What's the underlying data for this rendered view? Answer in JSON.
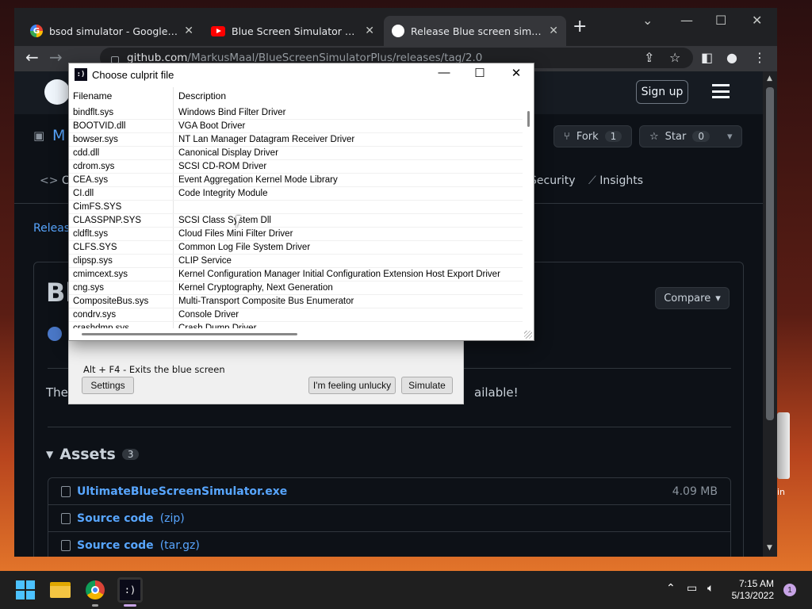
{
  "browser": {
    "tabs": [
      {
        "title": "bsod simulator - Google Search",
        "icon": "google-icon"
      },
      {
        "title": "Blue Screen Simulator Plus - Yo",
        "icon": "youtube-icon"
      },
      {
        "title": "Release Blue screen simulator",
        "icon": "github-icon"
      }
    ],
    "new_tab": "+",
    "url_host": "github.com",
    "url_path": "/MarkusMaal/BlueScreenSimulatorPlus/releases/tag/2.0"
  },
  "github": {
    "signup": "Sign up",
    "repo_initial": "M",
    "fork_label": "Fork",
    "fork_count": "1",
    "star_label": "Star",
    "star_count": "0",
    "tab_code": "C",
    "tab_security": "Security",
    "tab_insights": "Insights",
    "releases_link": "Release",
    "release_title": "Bl",
    "compare": "Compare",
    "desc_left": "The",
    "desc_right": "ailable!",
    "assets_label": "Assets",
    "assets_count": "3",
    "assets": [
      {
        "name": "UltimateBlueScreenSimulator.exe",
        "type": "",
        "size": "4.09 MB"
      },
      {
        "name": "Source code",
        "type": "(zip)",
        "size": ""
      },
      {
        "name": "Source code",
        "type": "(tar.gz)",
        "size": ""
      }
    ]
  },
  "simulator": {
    "hint": "Alt + F4 - Exits the blue screen",
    "settings": "Settings",
    "unlucky": "I'm feeling unlucky",
    "simulate": "Simulate"
  },
  "dialog": {
    "title": "Choose culprit file",
    "app_icon_text": ":)",
    "col_filename": "Filename",
    "col_description": "Description",
    "rows": [
      {
        "file": "bindflt.sys",
        "desc": "Windows Bind Filter Driver"
      },
      {
        "file": "BOOTVID.dll",
        "desc": "VGA Boot Driver"
      },
      {
        "file": "bowser.sys",
        "desc": "NT Lan Manager Datagram Receiver Driver"
      },
      {
        "file": "cdd.dll",
        "desc": "Canonical Display Driver"
      },
      {
        "file": "cdrom.sys",
        "desc": "SCSI CD-ROM Driver"
      },
      {
        "file": "CEA.sys",
        "desc": "Event Aggregation Kernel Mode Library"
      },
      {
        "file": "CI.dll",
        "desc": "Code Integrity Module"
      },
      {
        "file": "CimFS.SYS",
        "desc": ""
      },
      {
        "file": "CLASSPNP.SYS",
        "desc": "SCSI Class System Dll"
      },
      {
        "file": "cldflt.sys",
        "desc": "Cloud Files Mini Filter Driver"
      },
      {
        "file": "CLFS.SYS",
        "desc": "Common Log File System Driver"
      },
      {
        "file": "clipsp.sys",
        "desc": "CLIP Service"
      },
      {
        "file": "cmimcext.sys",
        "desc": "Kernel Configuration Manager Initial Configuration Extension Host Export Driver"
      },
      {
        "file": "cng.sys",
        "desc": "Kernel Cryptography, Next Generation"
      },
      {
        "file": "CompositeBus.sys",
        "desc": "Multi-Transport Composite Bus Enumerator"
      },
      {
        "file": "condrv.sys",
        "desc": "Console Driver"
      },
      {
        "file": "crashdmp.sys",
        "desc": "Crash Dump Driver"
      }
    ]
  },
  "desktop": {
    "recycle_label": "in"
  },
  "taskbar": {
    "time": "7:15 AM",
    "date": "5/13/2022",
    "notifications": "1",
    "bsod_icon_text": ":)"
  }
}
